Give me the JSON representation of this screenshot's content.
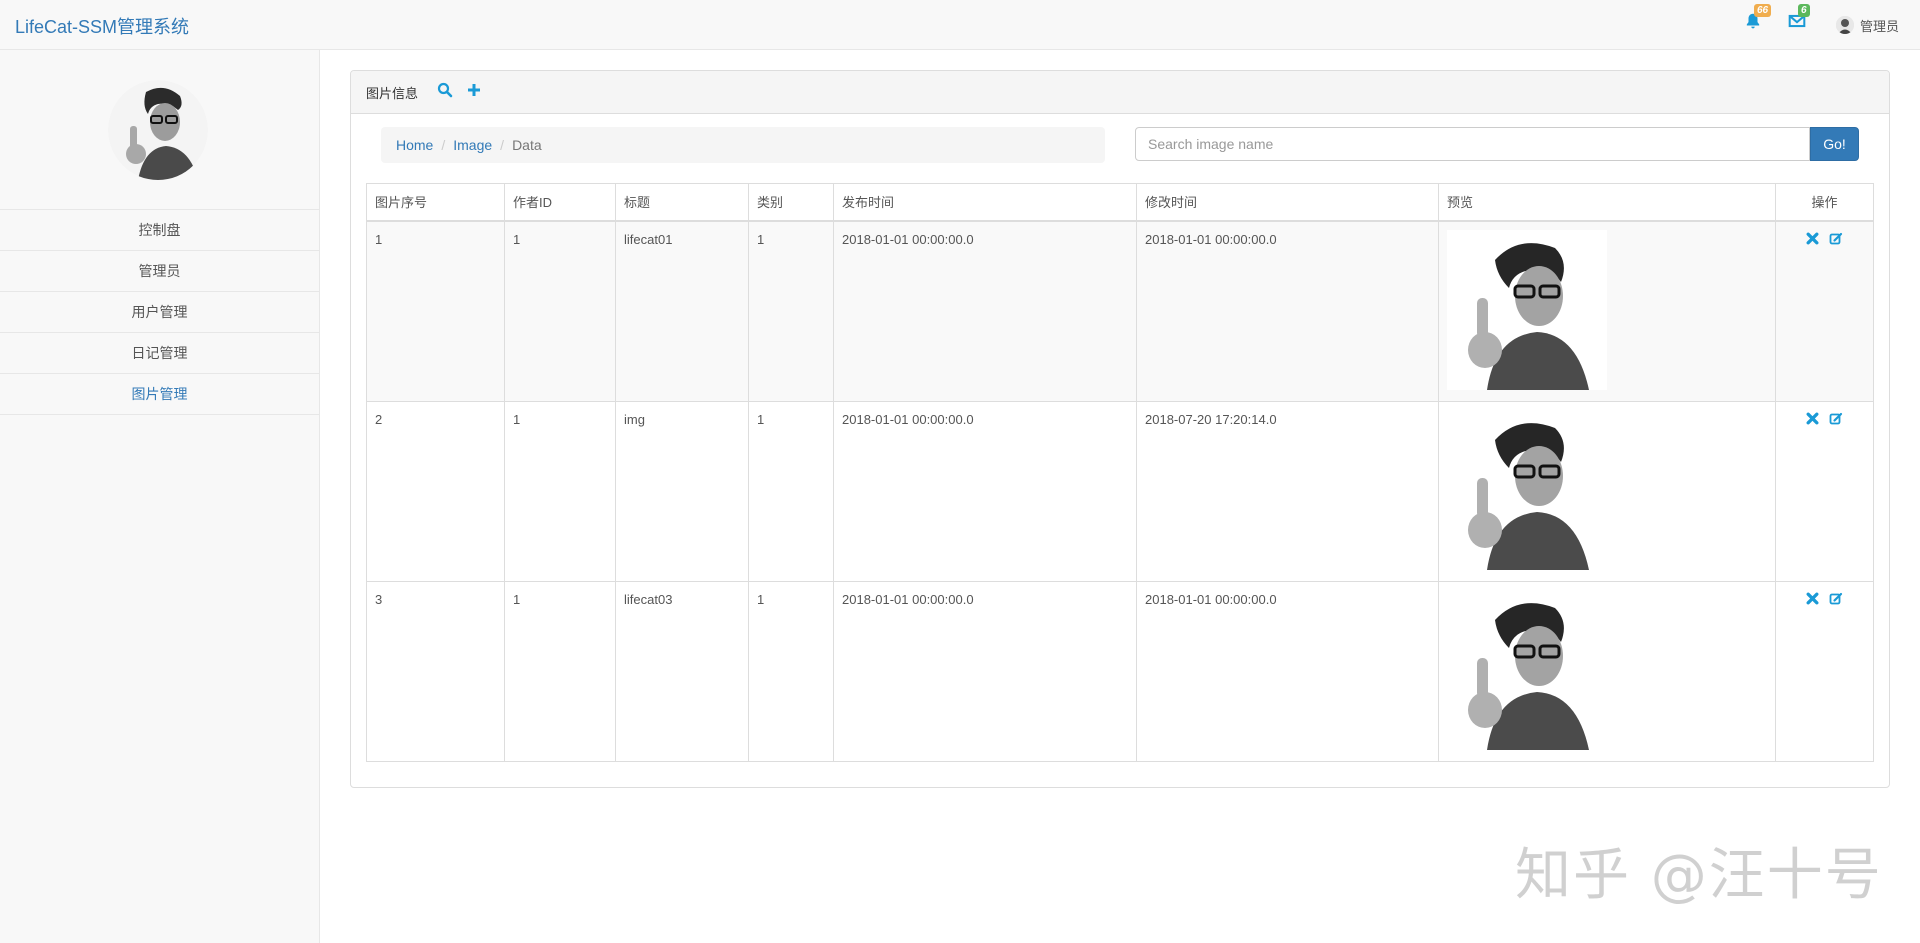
{
  "app": {
    "brand": "LifeCat-SSM管理系统"
  },
  "topbar": {
    "notifications": {
      "icon": "bell-icon",
      "count": "66"
    },
    "messages": {
      "icon": "envelope-icon",
      "count": "6"
    },
    "user": {
      "name": "管理员"
    }
  },
  "sidebar": {
    "items": [
      {
        "label": "控制盘"
      },
      {
        "label": "管理员"
      },
      {
        "label": "用户管理"
      },
      {
        "label": "日记管理"
      },
      {
        "label": "图片管理",
        "active": true
      }
    ]
  },
  "panel": {
    "title": "图片信息",
    "breadcrumb": {
      "home": "Home",
      "image": "Image",
      "current": "Data"
    },
    "search": {
      "placeholder": "Search image name",
      "button": "Go!"
    },
    "table": {
      "headers": [
        "图片序号",
        "作者ID",
        "标题",
        "类别",
        "发布时间",
        "修改时间",
        "预览",
        "操作"
      ],
      "rows": [
        {
          "id": "1",
          "author": "1",
          "title": "lifecat01",
          "category": "1",
          "published": "2018-01-01 00:00:00.0",
          "modified": "2018-01-01 00:00:00.0"
        },
        {
          "id": "2",
          "author": "1",
          "title": "img",
          "category": "1",
          "published": "2018-01-01 00:00:00.0",
          "modified": "2018-07-20 17:20:14.0"
        },
        {
          "id": "3",
          "author": "1",
          "title": "lifecat03",
          "category": "1",
          "published": "2018-01-01 00:00:00.0",
          "modified": "2018-01-01 00:00:00.0"
        }
      ]
    }
  },
  "watermark": "知乎 @汪十号",
  "colors": {
    "accent": "#337ab7",
    "icon_blue": "#1a9ad6"
  }
}
